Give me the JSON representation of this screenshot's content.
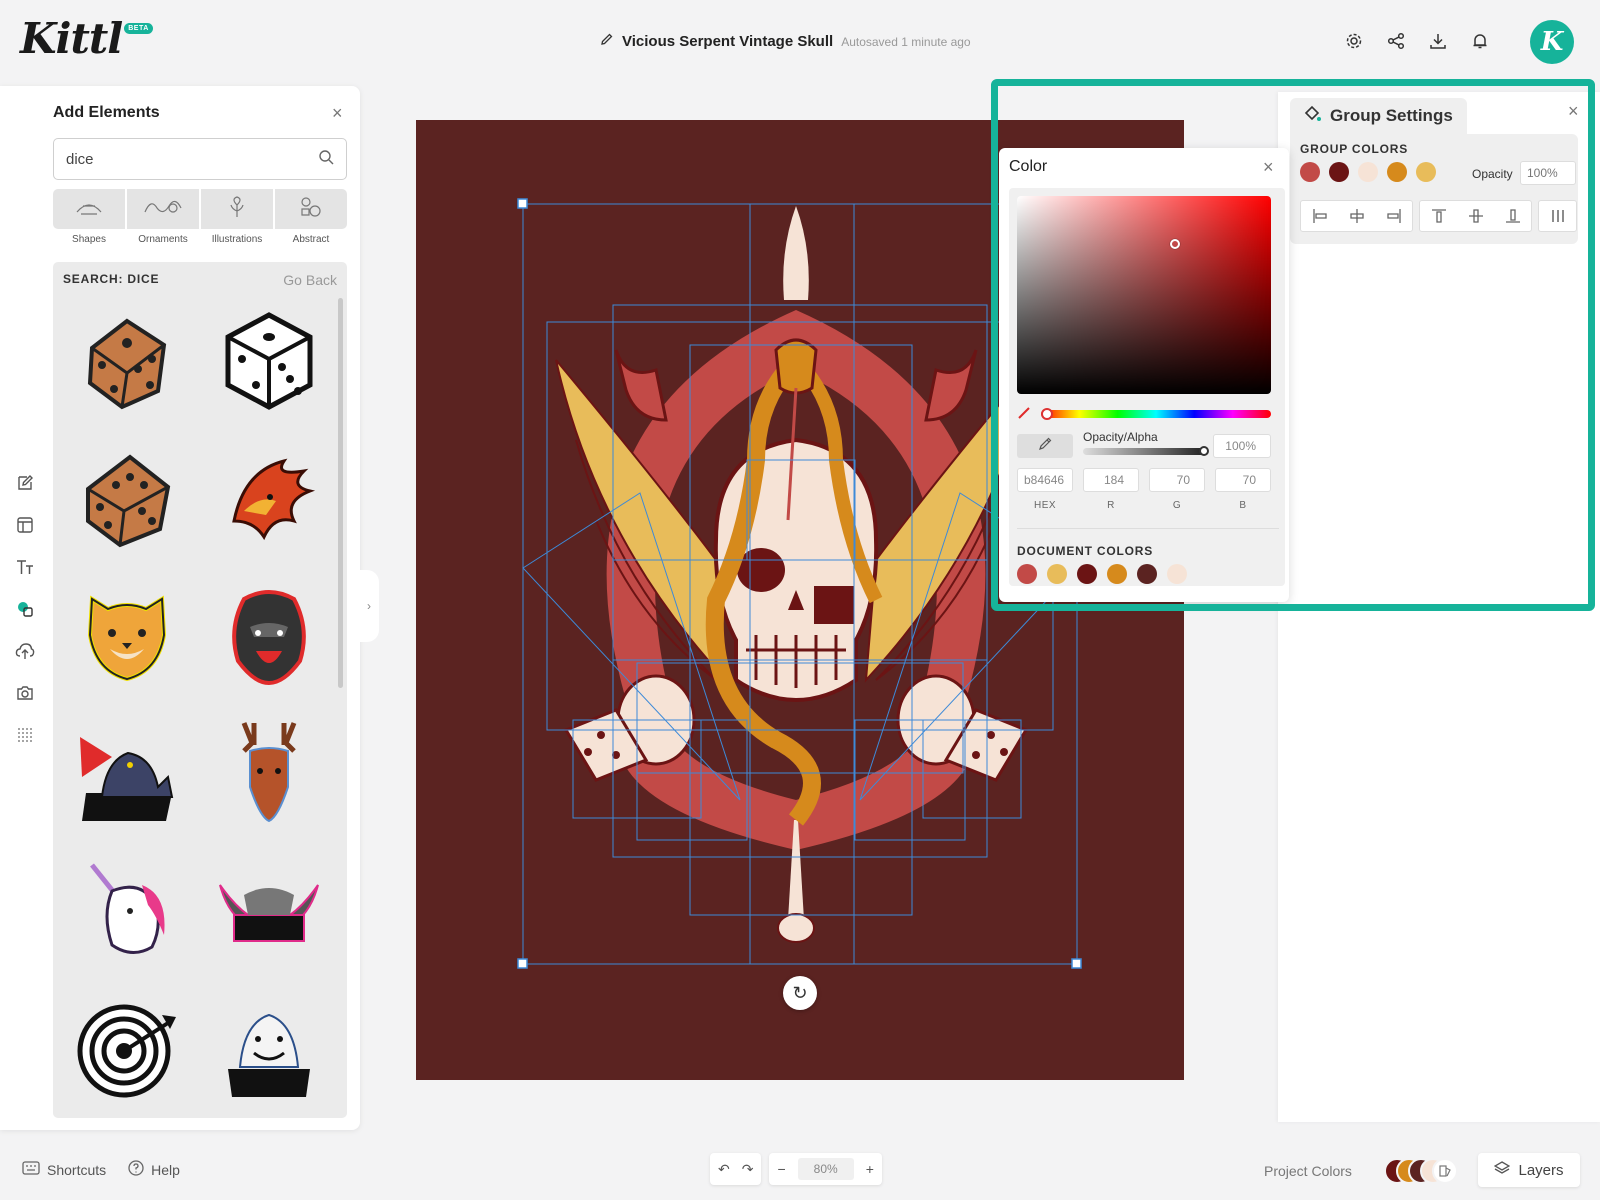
{
  "app": {
    "logo": "Kittl",
    "beta_badge": "BETA",
    "avatar_letter": "K",
    "brand_color": "#16b39a"
  },
  "header": {
    "doc_title": "Vicious Serpent Vintage Skull",
    "autosave": "Autosaved 1 minute ago",
    "icons": [
      "settings-icon",
      "share-icon",
      "download-icon",
      "bell-icon"
    ]
  },
  "tool_rail": [
    "edit-icon",
    "template-icon",
    "text-icon",
    "elements-icon",
    "upload-icon",
    "camera-icon",
    "more-icon"
  ],
  "add_elements": {
    "title": "Add Elements",
    "search_value": "dice",
    "categories": [
      {
        "label": "Shapes",
        "icon": "shapes-icon"
      },
      {
        "label": "Ornaments",
        "icon": "ornaments-icon"
      },
      {
        "label": "Illustrations",
        "icon": "illustrations-icon"
      },
      {
        "label": "Abstract",
        "icon": "abstract-icon"
      }
    ],
    "results_label": "SEARCH: DICE",
    "go_back": "Go Back",
    "results": [
      "brown-die",
      "white-die",
      "brown-die-2",
      "phoenix-mascot",
      "cheetah-mascot",
      "gorilla-mascot",
      "panther-fighter",
      "deer-mascot",
      "unicorn-mascot",
      "winged-banner",
      "dartboard-target",
      "bear-mascot"
    ]
  },
  "canvas": {
    "background": "#5b2321"
  },
  "group_settings": {
    "title": "Group Settings",
    "colors_label": "GROUP COLORS",
    "colors": [
      "#c24a47",
      "#6b1414",
      "#f6e3d6",
      "#d68a1c",
      "#e8bc5a"
    ],
    "opacity_label": "Opacity",
    "opacity_value": "100%",
    "align_icons": [
      "align-left-icon",
      "align-center-h-icon",
      "align-right-icon",
      "align-top-icon",
      "align-middle-icon",
      "align-bottom-icon",
      "distribute-icon"
    ]
  },
  "color_picker": {
    "title": "Color",
    "alpha_label": "Opacity/Alpha",
    "alpha_value": "100%",
    "hex": "b84646",
    "r": "184",
    "g": "70",
    "b": "70",
    "hex_label": "HEX",
    "r_label": "R",
    "g_label": "G",
    "b_label": "B",
    "doc_colors_label": "DOCUMENT COLORS",
    "doc_colors": [
      "#c24a47",
      "#e8bc5a",
      "#6b1414",
      "#d68a1c",
      "#5b2321",
      "#f6e3d6"
    ]
  },
  "footer": {
    "shortcuts": "Shortcuts",
    "help": "Help",
    "zoom": "80%",
    "project_colors": "Project Colors",
    "layers": "Layers"
  }
}
